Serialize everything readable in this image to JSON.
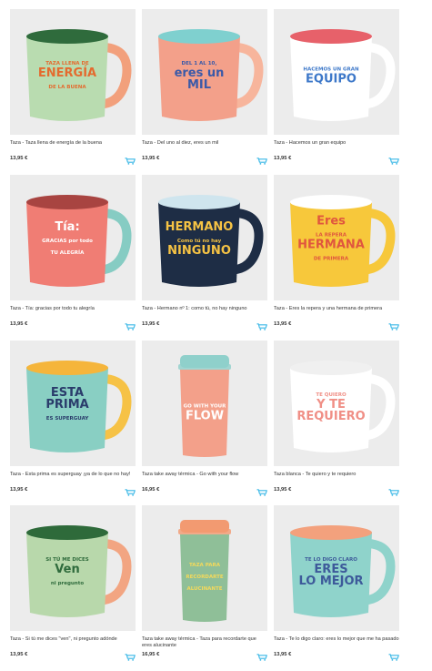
{
  "products": [
    {
      "name": "Taza - Taza llena de energía de la buena",
      "price": "13,95 €",
      "print": [
        "TAZA LLENA DE",
        "ENERGÍA",
        "DE LA BUENA"
      ],
      "colors": {
        "body": "#b9dcb0",
        "rim": "#2f6b3c",
        "handle": "#f2a07c",
        "ink": "#e46b2f"
      }
    },
    {
      "name": "Taza - Del uno al diez, eres un mil",
      "price": "13,95 €",
      "print": [
        "DEL 1 AL 10,",
        "eres un",
        "MIL"
      ],
      "colors": {
        "body": "#f3a08a",
        "rim": "#7fd0cf",
        "handle": "#f7b59c",
        "ink": "#3b5aa8"
      }
    },
    {
      "name": "Taza - Hacemos un gran equipo",
      "price": "13,95 €",
      "print": [
        "HACEMOS UN GRAN",
        "EQUIPO"
      ],
      "colors": {
        "body": "#ffffff",
        "rim": "#e7616a",
        "handle": "#ffffff",
        "ink": "#3d78c9"
      }
    },
    {
      "name": "Taza - Tía: gracias por todo tu alegría",
      "price": "13,95 €",
      "print": [
        "Tía:",
        "GRACIAS por todo",
        "TU ALEGRÍA"
      ],
      "colors": {
        "body": "#f07d74",
        "rim": "#a84441",
        "handle": "#86ccc3",
        "ink": "#ffffff"
      }
    },
    {
      "name": "Taza - Hermano nº 1: como tú, no hay ninguno",
      "price": "13,95 €",
      "print": [
        "HERMANO",
        "Como tú no hay",
        "NINGUNO"
      ],
      "colors": {
        "body": "#1e2d45",
        "rim": "#cfe5ee",
        "handle": "#1e2d45",
        "ink": "#f6c344"
      }
    },
    {
      "name": "Taza - Eres la repera y una hermana de primera",
      "price": "13,95 €",
      "print": [
        "Eres",
        "LA REPERA",
        "HERMANA",
        "DE PRIMERA"
      ],
      "colors": {
        "body": "#f7c83b",
        "rim": "#ffffff",
        "handle": "#f7c83b",
        "ink": "#e0563e"
      }
    },
    {
      "name": "Taza - Esta prima es superguay ¡ya de lo que no hay!",
      "price": "13,95 €",
      "print": [
        "ESTA",
        "PRIMA",
        "ES SUPERGUAY"
      ],
      "colors": {
        "body": "#89cfc3",
        "rim": "#f5b53b",
        "handle": "#f6c246",
        "ink": "#2a3c6b"
      }
    },
    {
      "name": "Taza take away térmica - Go with your flow",
      "price": "16,95 €",
      "print": [
        "GO WITH YOUR",
        "FLOW"
      ],
      "colors": {
        "body": "#f3a08a",
        "rim": "#8fd0cb",
        "handle": "#f3a08a",
        "ink": "#ffffff"
      }
    },
    {
      "name": "Taza blanca - Te quiero y te requiero",
      "price": "13,95 €",
      "print": [
        "TE QUIERO",
        "Y TE",
        "REQUIERO"
      ],
      "colors": {
        "body": "#ffffff",
        "rim": "#f0f0f0",
        "handle": "#ffffff",
        "ink": "#f08f86"
      }
    },
    {
      "name": "Taza - Si tú me dices \"ven\", ni pregunto adónde",
      "price": "13,95 €",
      "print": [
        "SI TÚ ME DICES",
        "Ven",
        "ni pregunto"
      ],
      "colors": {
        "body": "#b8d8ab",
        "rim": "#2e6a3a",
        "handle": "#f2a582",
        "ink": "#2f6b3c"
      }
    },
    {
      "name": "Taza take away térmica - Taza para recordarte que eres alucinante",
      "price": "16,95 €",
      "print": [
        "TAZA PARA",
        "RECORDARTE",
        "ALUCINANTE"
      ],
      "colors": {
        "body": "#8fbf98",
        "rim": "#f29a71",
        "handle": "#8fbf98",
        "ink": "#f4d95a"
      }
    },
    {
      "name": "Taza - Te lo digo claro: eres lo mejor que me ha pasado",
      "price": "13,95 €",
      "print": [
        "TE LO DIGO CLARO",
        "ERES",
        "LO MEJOR"
      ],
      "colors": {
        "body": "#8fd3cb",
        "rim": "#f3a17d",
        "handle": "#8fd3cb",
        "ink": "#3d5a9a"
      }
    }
  ]
}
